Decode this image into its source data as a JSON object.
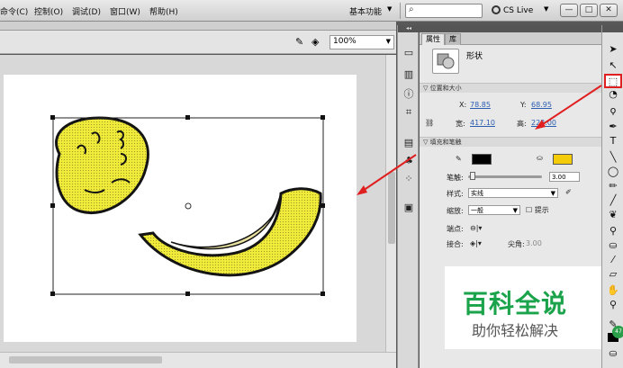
{
  "menubar": {
    "items": [
      "命令(C)",
      "控制(O)",
      "调试(D)",
      "窗口(W)",
      "帮助(H)"
    ],
    "workspace": "基本功能",
    "search_placeholder": "",
    "cs_live": "CS Live",
    "window_buttons": [
      "—",
      "□",
      "✕"
    ]
  },
  "stage": {
    "zoom": "100%"
  },
  "panel": {
    "tabs": [
      "属性",
      "库"
    ],
    "object_type": "形状",
    "position_size": {
      "section_label": "位置和大小",
      "x_label": "X:",
      "x_value": "78.85",
      "y_label": "Y:",
      "y_value": "68.95",
      "w_label": "宽:",
      "w_value": "417.10",
      "h_label": "高:",
      "h_value": "223.00"
    },
    "fill_stroke": {
      "section_label": "填充和笔触",
      "stroke_color": "#000000",
      "fill_color": "#f4cc0a",
      "stroke_label": "笔触:",
      "stroke_value": "3.00",
      "style_label": "样式:",
      "style_value": "实线",
      "scale_label": "缩放:",
      "scale_value": "一般",
      "hint_label": "提示",
      "cap_label": "端点:",
      "join_label": "接合:",
      "miter_label": "尖角:",
      "miter_value": "3.00"
    }
  },
  "watermark": {
    "title": "百科全说",
    "subtitle": "助你轻松解决"
  },
  "artwork": {
    "fill_color": "#f0ea3a",
    "outline_color": "#141414"
  },
  "badge": {
    "text": "47"
  }
}
